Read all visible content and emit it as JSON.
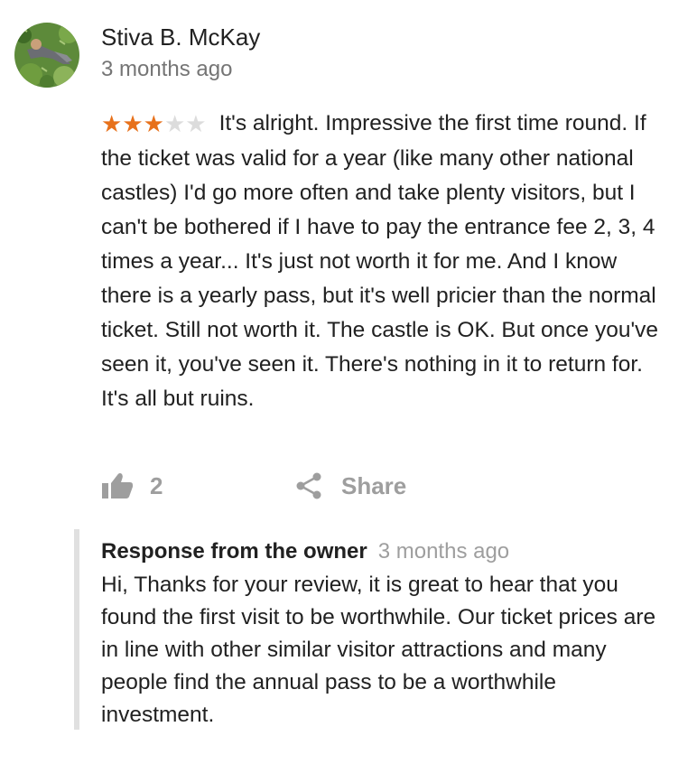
{
  "review": {
    "author": "Stiva B. McKay",
    "time_ago": "3 months ago",
    "rating": 3,
    "max_rating": 5,
    "text": "It's alright. Impressive the first time round. If the ticket was valid for a year (like many other national castles) I'd go more often and take plenty visitors, but I can't be bothered if I have to pay the entrance fee 2, 3, 4 times a year... It's just not worth it for me. And I know there is a yearly pass, but it's well pricier than the normal ticket. Still not worth it. The castle is OK. But once you've seen it, you've seen it. There's nothing in it to return for. It's all but ruins."
  },
  "actions": {
    "like_count": "2",
    "like_icon": "thumbs-up-icon",
    "share_label": "Share",
    "share_icon": "share-icon"
  },
  "owner_response": {
    "title": "Response from the owner",
    "time_ago": "3 months ago",
    "text": "Hi, Thanks for your review, it is great to hear that you found the first visit to be worthwhile. Our ticket prices are in line with other similar visitor attractions and many people find the annual pass to be a worthwhile investment."
  },
  "colors": {
    "star_filled": "#e7711b",
    "star_empty": "#dcdcdc",
    "muted_text": "#757575",
    "action_gray": "#9e9e9e",
    "response_border": "#e0e0e0"
  }
}
